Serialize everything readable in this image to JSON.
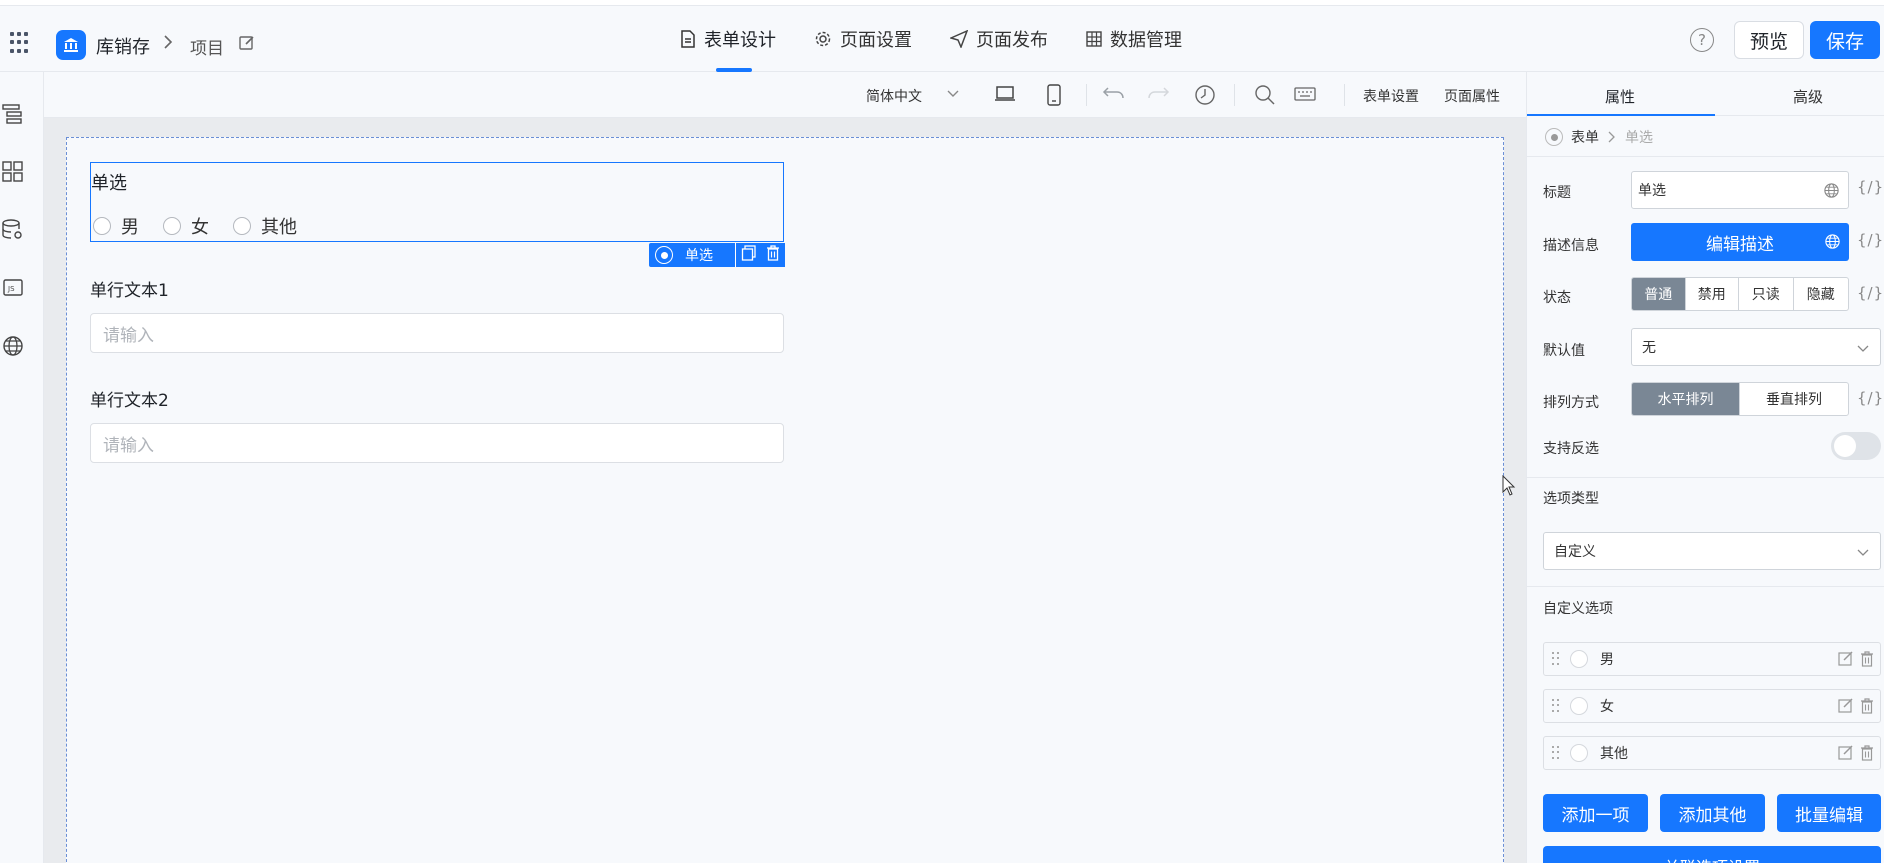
{
  "header": {
    "app_name": "库销存",
    "breadcrumb_item": "项目",
    "tabs": [
      {
        "label": "表单设计",
        "icon": "document-icon",
        "active": true
      },
      {
        "label": "页面设置",
        "icon": "gear-icon",
        "active": false
      },
      {
        "label": "页面发布",
        "icon": "send-icon",
        "active": false
      },
      {
        "label": "数据管理",
        "icon": "table-icon",
        "active": false
      }
    ],
    "help_label": "?",
    "preview_label": "预览",
    "save_label": "保存"
  },
  "canvas_toolbar": {
    "language": "简体中文",
    "form_settings": "表单设置",
    "page_props": "页面属性"
  },
  "form": {
    "radio_field": {
      "label": "单选",
      "options": [
        "男",
        "女",
        "其他"
      ],
      "badge_label": "单选"
    },
    "text_fields": [
      {
        "label": "单行文本1",
        "placeholder": "请输入"
      },
      {
        "label": "单行文本2",
        "placeholder": "请输入"
      }
    ]
  },
  "panel": {
    "tabs": [
      "属性",
      "高级"
    ],
    "active_tab": "属性",
    "breadcrumb": [
      "表单",
      "单选"
    ],
    "title_label": "标题",
    "title_value": "单选",
    "desc_label": "描述信息",
    "desc_button": "编辑描述",
    "state_label": "状态",
    "state_options": [
      "普通",
      "禁用",
      "只读",
      "隐藏"
    ],
    "state_selected": "普通",
    "default_label": "默认值",
    "default_value": "无",
    "layout_label": "排列方式",
    "layout_options": [
      "水平排列",
      "垂直排列"
    ],
    "layout_selected": "水平排列",
    "deselect_label": "支持反选",
    "deselect_enabled": false,
    "option_type_label": "选项类型",
    "option_type_value": "自定义",
    "custom_options_label": "自定义选项",
    "custom_options": [
      "男",
      "女",
      "其他"
    ],
    "add_one": "添加一项",
    "add_other": "添加其他",
    "batch_edit": "批量编辑",
    "linked_settings": "关联选项设置",
    "fx_label": "{/}"
  },
  "colors": {
    "primary": "#1677ff",
    "segment_on": "#7a8795"
  }
}
